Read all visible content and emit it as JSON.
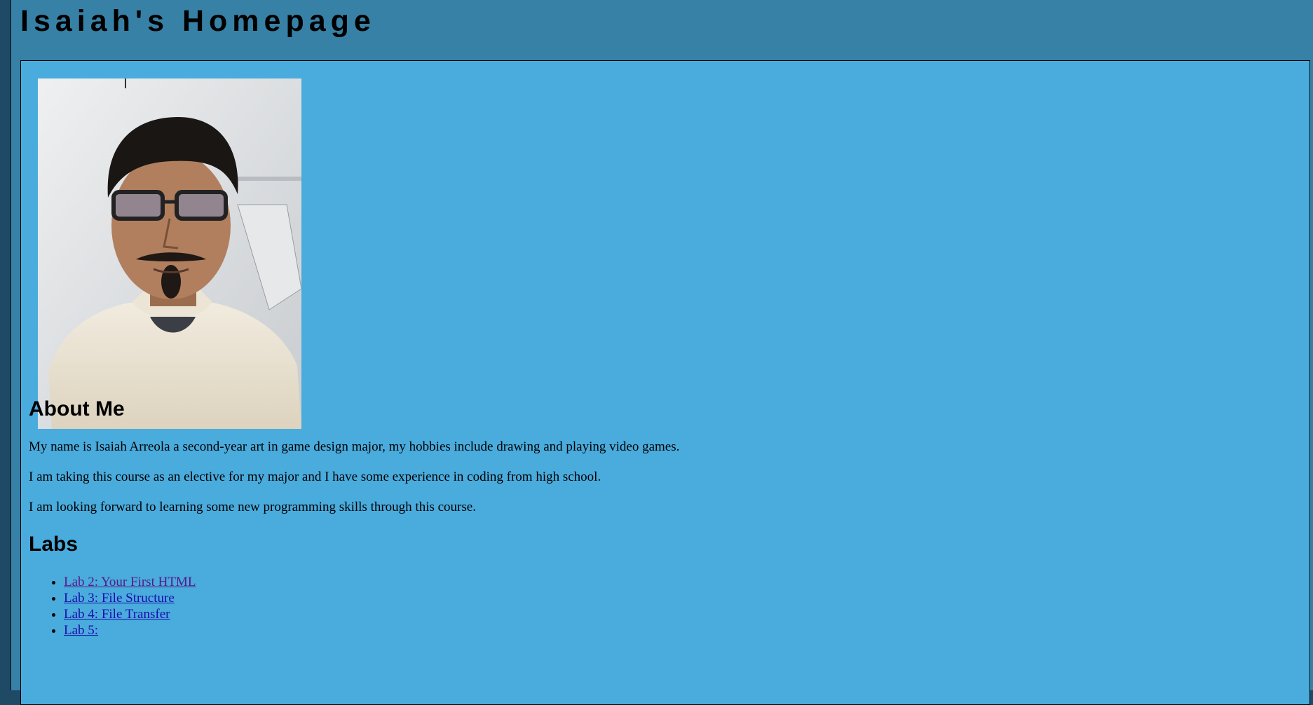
{
  "header": {
    "title": "Isaiah's Homepage"
  },
  "profile": {
    "photo_alt": "Photo of Isaiah"
  },
  "about": {
    "heading": "About Me",
    "paragraphs": [
      "My name is Isaiah Arreola a second-year art in game design major, my hobbies include drawing and playing video games.",
      "I am taking this course as an elective for my major and I have some experience in coding from high school.",
      "I am looking forward to learning some new programming skills through this course."
    ]
  },
  "labs": {
    "heading": "Labs",
    "items": [
      {
        "label": "Lab 2: Your First HTML",
        "visited": true
      },
      {
        "label": "Lab 3: File Structure",
        "visited": false
      },
      {
        "label": "Lab 4: File Transfer",
        "visited": false
      },
      {
        "label": "Lab 5:",
        "visited": false
      }
    ]
  },
  "colors": {
    "outer_background": "#1e4a66",
    "header_background": "#3781a6",
    "panel_background": "#4aabdd",
    "link": "#1a0dab",
    "visited_link": "#551a8b"
  }
}
